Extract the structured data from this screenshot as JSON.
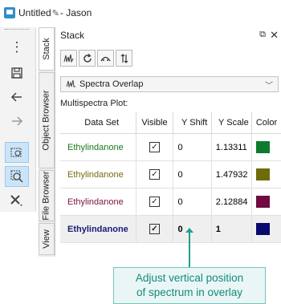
{
  "window": {
    "title_prefix": "Untitled",
    "title_suffix": "- Jason",
    "edit_icon": "pencil-icon"
  },
  "left_toolbar": {
    "buttons": [
      {
        "icon": "more-vertical-icon"
      },
      {
        "icon": "save-icon"
      },
      {
        "icon": "undo-icon"
      },
      {
        "icon": "redo-icon"
      },
      {
        "icon": "zoom-region-icon"
      },
      {
        "icon": "zoom-select-icon"
      },
      {
        "icon": "tools-icon"
      }
    ]
  },
  "side_tabs": [
    "Stack",
    "Object Browser",
    "File Browser",
    "View"
  ],
  "panel": {
    "title": "Stack",
    "pin_icon": "pin-icon",
    "close_icon": "close-icon",
    "tools": [
      {
        "icon": "spectra-view-icon"
      },
      {
        "icon": "refresh-icon"
      },
      {
        "icon": "overlay-icon"
      },
      {
        "icon": "sort-icon"
      }
    ],
    "dropdown": {
      "label": "Spectra Overlap",
      "icon": "spectra-overlap-icon"
    },
    "section_label": "Multispectra Plot:",
    "columns": [
      "Data Set",
      "Visible",
      "Y Shift",
      "Y Scale",
      "Color"
    ],
    "rows": [
      {
        "name": "Ethylindanone",
        "name_color": "#1a7a1a",
        "visible": true,
        "y_shift": "0",
        "y_scale": "1.13311",
        "color": "#0e7a2c",
        "selected": false
      },
      {
        "name": "Ethylindanone",
        "name_color": "#7a6a10",
        "visible": true,
        "y_shift": "0",
        "y_scale": "1.47932",
        "color": "#6f6a0a",
        "selected": false
      },
      {
        "name": "Ethylindanone",
        "name_color": "#7a1444",
        "visible": true,
        "y_shift": "0",
        "y_scale": "2.12884",
        "color": "#700b3f",
        "selected": false
      },
      {
        "name": "Ethylindanone",
        "name_color": "#1a1a7a",
        "visible": true,
        "y_shift": "0",
        "y_scale": "1",
        "color": "#08086e",
        "selected": true
      }
    ]
  },
  "callout": {
    "text": "Adjust vertical position\nof spectrum in overlay",
    "color": "#1fa08f"
  }
}
